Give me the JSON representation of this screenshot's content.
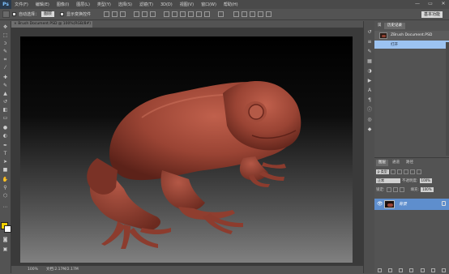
{
  "app": {
    "logo": "Ps"
  },
  "menu": [
    "文件(F)",
    "编辑(E)",
    "图像(I)",
    "图层(L)",
    "类型(Y)",
    "选择(S)",
    "滤镜(T)",
    "3D(D)",
    "视图(V)",
    "窗口(W)",
    "帮助(H)"
  ],
  "window_controls": {
    "minimize": "—",
    "restore": "▭",
    "close": "✕"
  },
  "options": {
    "auto_select_label": "自动选择：",
    "auto_select_value": "图层",
    "show_transform_label": "显示变换控件"
  },
  "workspace": {
    "label": "基本功能"
  },
  "document": {
    "tab_title": "Brush Document.PSD @ 100%(RGB/8#)",
    "tab_close": "×",
    "zoom": "100%",
    "doc_size": "文档:2.17M/2.17M"
  },
  "panels": {
    "tabs": [
      "历史记录"
    ],
    "tab_inactive": "属",
    "history": [
      {
        "label": "ZBrush Document.PSD"
      },
      {
        "label": "打开"
      }
    ]
  },
  "layers": {
    "tabs": [
      "图层",
      "通道",
      "路径"
    ],
    "kind_label": "p 类型",
    "blend_mode": "正常",
    "opacity_label": "不透明度:",
    "opacity_value": "100%",
    "lock_label": "锁定:",
    "fill_label": "填充:",
    "fill_value": "100%",
    "layer_name": "背景"
  },
  "colors": {
    "foreground": "#f2d000",
    "background": "#ffffff",
    "selection": "#5e8ecd",
    "history_selected": "#9cc3f1"
  }
}
